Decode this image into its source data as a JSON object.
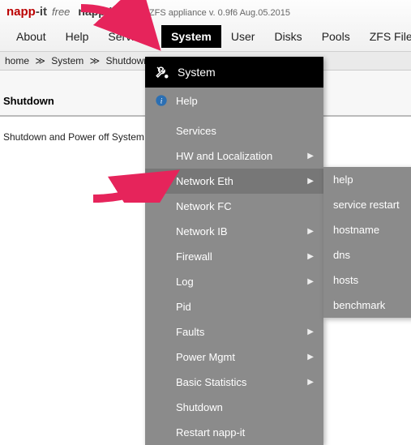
{
  "header": {
    "logo_napp": "napp",
    "logo_it": "-it",
    "logo_free": "free",
    "tag": "napp-it-15d",
    "version": "ZFS appliance v. 0.9f6 Aug.05.2015"
  },
  "menu": {
    "about": "About",
    "help": "Help",
    "services": "Services",
    "system": "System",
    "user": "User",
    "disks": "Disks",
    "pools": "Pools",
    "zfs": "ZFS Filesystems"
  },
  "breadcrumb": {
    "home": "home",
    "system": "System",
    "shutdown": "Shutdown",
    "sep": "≫"
  },
  "page": {
    "title": "Shutdown",
    "msg": "Shutdown and Power off System initiated. Power Off as soon possible."
  },
  "dropdown": {
    "head": "System",
    "items": [
      {
        "label": "Help",
        "icon": "info",
        "arrow": false,
        "hl": false
      },
      {
        "label": "Services",
        "arrow": false,
        "hl": false
      },
      {
        "label": "HW and Localization",
        "arrow": true,
        "hl": false
      },
      {
        "label": "Network Eth",
        "arrow": true,
        "hl": true
      },
      {
        "label": "Network FC",
        "arrow": false,
        "hl": false
      },
      {
        "label": "Network IB",
        "arrow": true,
        "hl": false
      },
      {
        "label": "Firewall",
        "arrow": true,
        "hl": false
      },
      {
        "label": "Log",
        "arrow": true,
        "hl": false
      },
      {
        "label": "Pid",
        "arrow": false,
        "hl": false
      },
      {
        "label": "Faults",
        "arrow": true,
        "hl": false
      },
      {
        "label": "Power Mgmt",
        "arrow": true,
        "hl": false
      },
      {
        "label": "Basic Statistics",
        "arrow": true,
        "hl": false
      },
      {
        "label": "Shutdown",
        "arrow": false,
        "hl": false
      },
      {
        "label": "Restart napp-it",
        "arrow": false,
        "hl": false
      }
    ]
  },
  "submenu": {
    "items": [
      "help",
      "service restart",
      "hostname",
      "dns",
      "hosts",
      "benchmark"
    ]
  }
}
